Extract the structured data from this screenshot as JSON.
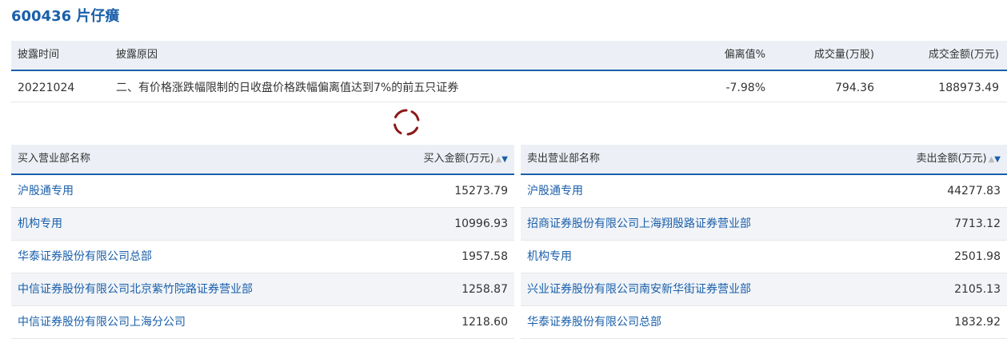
{
  "title": "600436 片仔癀",
  "disclosure": {
    "headers": {
      "time": "披露时间",
      "reason": "披露原因",
      "deviation": "偏离值%",
      "volume": "成交量(万股)",
      "amount": "成交金额(万元)"
    },
    "row": {
      "time": "20221024",
      "reason": "二、有价格涨跌幅限制的日收盘价格跌幅偏离值达到7%的前五只证券",
      "deviation": "-7.98%",
      "volume": "794.36",
      "amount": "188973.49"
    }
  },
  "buy": {
    "header_name": "买入营业部名称",
    "header_amount": "买入金额(万元)",
    "rows": [
      {
        "name": "沪股通专用",
        "amount": "15273.79"
      },
      {
        "name": "机构专用",
        "amount": "10996.93"
      },
      {
        "name": "华泰证券股份有限公司总部",
        "amount": "1957.58"
      },
      {
        "name": "中信证券股份有限公司北京紫竹院路证券营业部",
        "amount": "1258.87"
      },
      {
        "name": "中信证券股份有限公司上海分公司",
        "amount": "1218.60"
      }
    ]
  },
  "sell": {
    "header_name": "卖出营业部名称",
    "header_amount": "卖出金额(万元)",
    "rows": [
      {
        "name": "沪股通专用",
        "amount": "44277.83"
      },
      {
        "name": "招商证券股份有限公司上海翔殷路证券营业部",
        "amount": "7713.12"
      },
      {
        "name": "机构专用",
        "amount": "2501.98"
      },
      {
        "name": "兴业证券股份有限公司南安新华街证券营业部",
        "amount": "2105.13"
      },
      {
        "name": "华泰证券股份有限公司总部",
        "amount": "1832.92"
      }
    ]
  },
  "colors": {
    "accent": "#1a5faa",
    "header_bg": "#ecf0f6",
    "spinner": "#8b1a1a"
  },
  "icons": {
    "loading": "loading-spinner-icon",
    "sort": "sort-arrows-icon"
  }
}
